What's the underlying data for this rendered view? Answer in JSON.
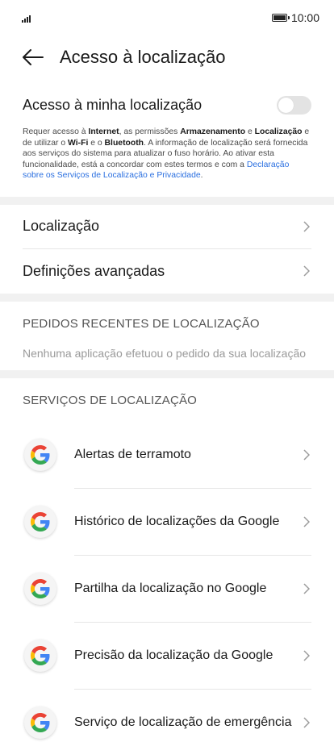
{
  "status_bar": {
    "time": "10:00",
    "battery_level": 1.0
  },
  "header": {
    "title": "Acesso à localização"
  },
  "main_toggle": {
    "label": "Acesso à minha localização",
    "state": "off",
    "description": {
      "p1": "Requer acesso à ",
      "b1": "Internet",
      "p2": ", as permissões ",
      "b2": "Armazenamento",
      "p3": " e ",
      "b3": "Localização",
      "p4": " e de utilizar o ",
      "b4": "Wi-Fi",
      "p5": " e o ",
      "b5": "Bluetooth",
      "p6": ". A informação de localização será fornecida aos serviços do sistema para atualizar o fuso horário. Ao ativar esta funcionalidade, está a concordar com estes termos e com a ",
      "link": "Declaração sobre os Serviços de Localização e Privacidade",
      "p7": "."
    }
  },
  "nav_items": [
    {
      "label": "Localização"
    },
    {
      "label": "Definições avançadas"
    }
  ],
  "recent_requests": {
    "header": "PEDIDOS RECENTES DE LOCALIZAÇÃO",
    "empty_message": "Nenhuma aplicação efetuou o pedido da sua localização"
  },
  "location_services": {
    "header": "SERVIÇOS DE LOCALIZAÇÃO",
    "items": [
      {
        "label": "Alertas de terramoto",
        "icon": "google-icon"
      },
      {
        "label": "Histórico de localizações da Google",
        "icon": "google-icon"
      },
      {
        "label": "Partilha da localização no Google",
        "icon": "google-icon"
      },
      {
        "label": "Precisão da localização da Google",
        "icon": "google-icon"
      },
      {
        "label": "Serviço de localização de emergência",
        "icon": "google-icon"
      }
    ]
  },
  "colors": {
    "link": "#2a6fe0",
    "toggle_off": "#e3e3e3",
    "section_gap": "#f1f1f1",
    "google_blue": "#4285F4",
    "google_red": "#EA4335",
    "google_yellow": "#FBBC05",
    "google_green": "#34A853"
  }
}
